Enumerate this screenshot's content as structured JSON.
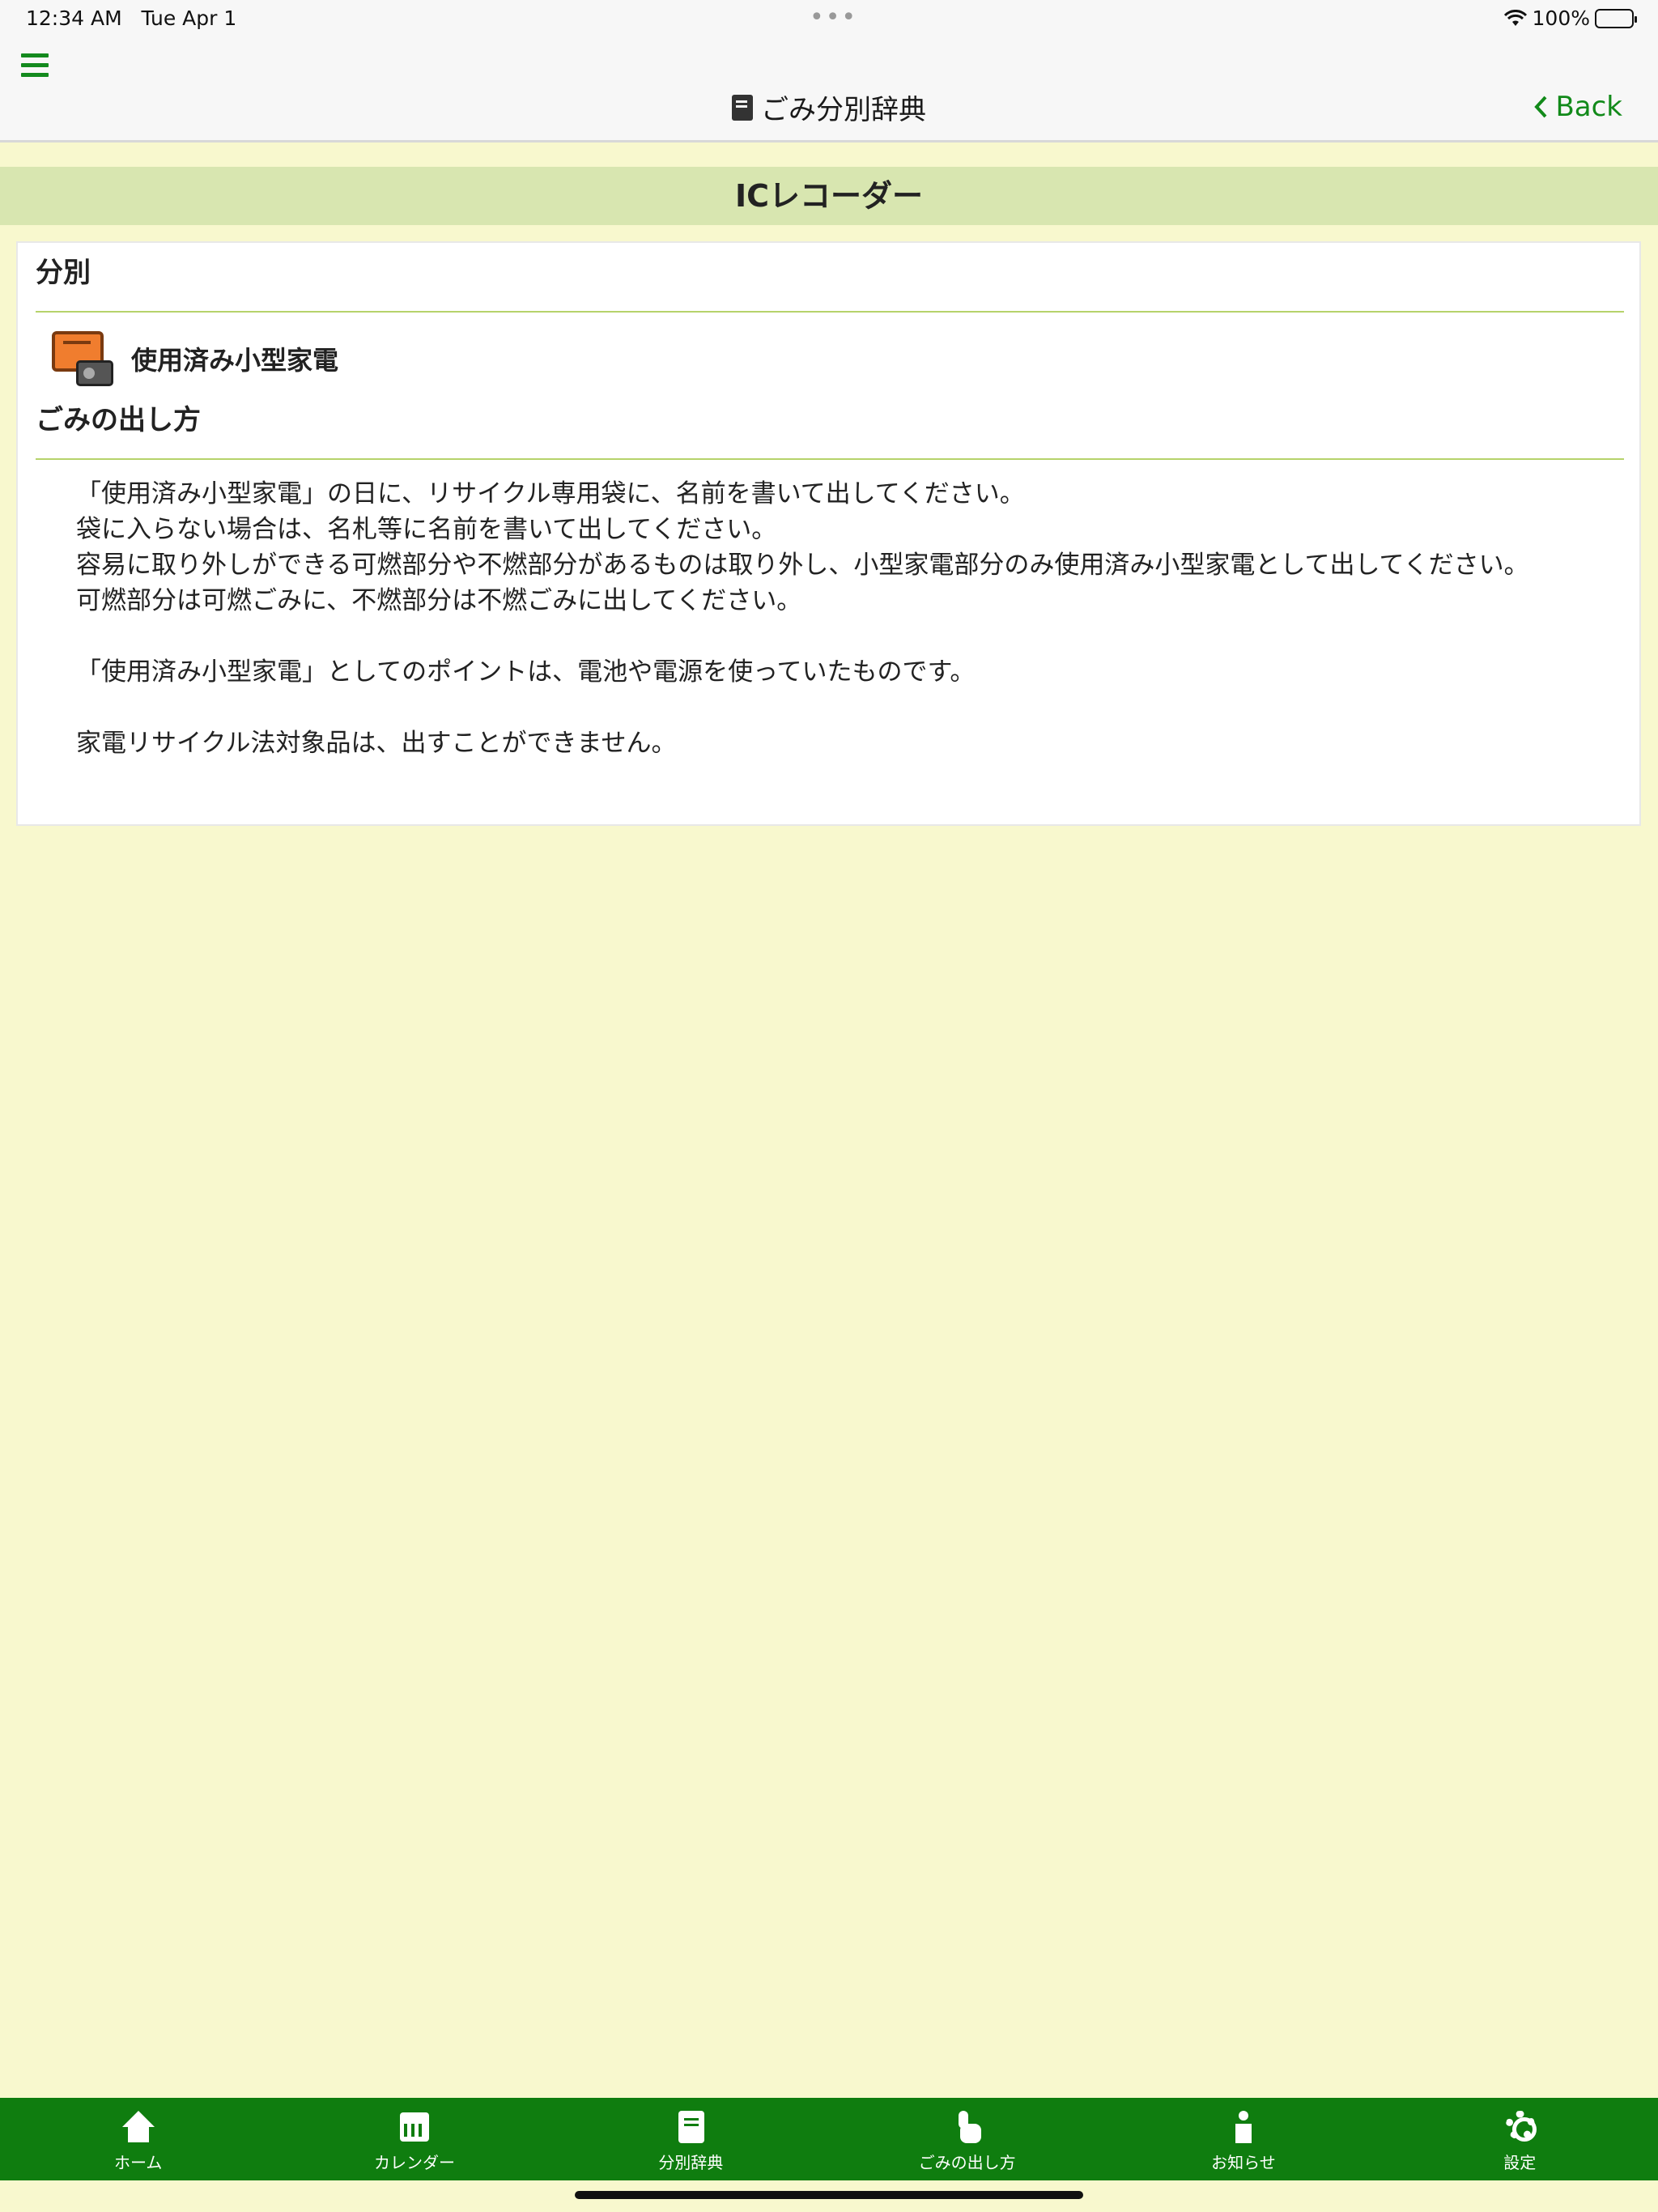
{
  "status_bar": {
    "time": "12:34 AM",
    "date": "Tue Apr 1",
    "dots": "•••",
    "battery": "100%"
  },
  "nav": {
    "title": "ごみ分別辞典",
    "back_label": "Back"
  },
  "item": {
    "name": "ICレコーダー"
  },
  "classification": {
    "heading": "分別",
    "category": "使用済み小型家電"
  },
  "disposal": {
    "heading": "ごみの出し方",
    "lines": [
      "「使用済み小型家電」の日に、リサイクル専用袋に、名前を書いて出してください。",
      "袋に入らない場合は、名札等に名前を書いて出してください。",
      "容易に取り外しができる可燃部分や不燃部分があるものは取り外し、小型家電部分のみ使用済み小型家電として出してください。",
      "可燃部分は可燃ごみに、不燃部分は不燃ごみに出してください。",
      "「使用済み小型家電」としてのポイントは、電池や電源を使っていたものです。",
      "家電リサイクル法対象品は、出すことができません。"
    ]
  },
  "tabs": [
    {
      "label": "ホーム",
      "icon": "home-icon"
    },
    {
      "label": "カレンダー",
      "icon": "calendar-icon"
    },
    {
      "label": "分別辞典",
      "icon": "book-icon"
    },
    {
      "label": "ごみの出し方",
      "icon": "hand-pointer-icon"
    },
    {
      "label": "お知らせ",
      "icon": "info-icon"
    },
    {
      "label": "設定",
      "icon": "gear-icon"
    }
  ],
  "colors": {
    "accent_green": "#0f7d0f",
    "header_band": "#d8e6b0",
    "background": "#f8f8ce"
  }
}
